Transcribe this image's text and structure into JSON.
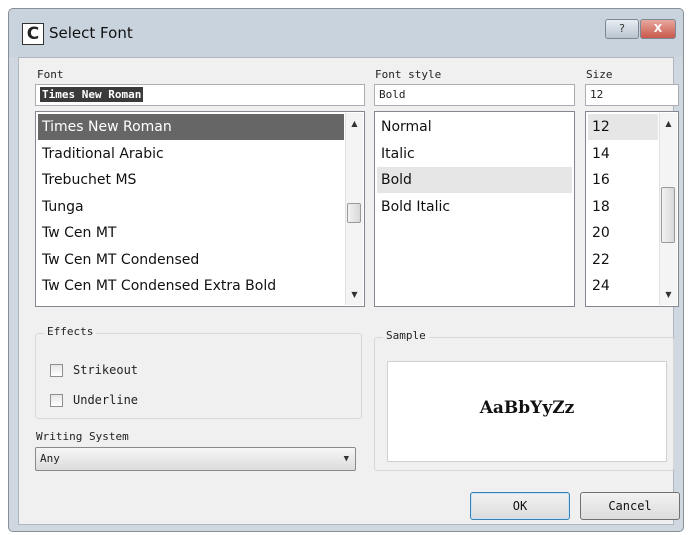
{
  "window": {
    "title": "Select Font",
    "app_icon": "C",
    "help_label": "?",
    "close_label": "X"
  },
  "font": {
    "label": "Font",
    "input_value": "Times New Roman",
    "items": [
      "Times New Roman",
      "Traditional Arabic",
      "Trebuchet MS",
      "Tunga",
      "Tw Cen MT",
      "Tw Cen MT Condensed",
      "Tw Cen MT Condensed Extra Bold"
    ],
    "selected": "Times New Roman"
  },
  "font_style": {
    "label": "Font style",
    "input_value": "Bold",
    "items": [
      "Normal",
      "Italic",
      "Bold",
      "Bold Italic"
    ],
    "selected": "Bold"
  },
  "size": {
    "label": "Size",
    "input_value": "12",
    "items": [
      "12",
      "14",
      "16",
      "18",
      "20",
      "22",
      "24"
    ],
    "selected": "12"
  },
  "effects": {
    "title": "Effects",
    "strikeout_label": "Strikeout",
    "underline_label": "Underline",
    "strikeout_checked": false,
    "underline_checked": false
  },
  "writing_system": {
    "label": "Writing System",
    "value": "Any"
  },
  "sample": {
    "title": "Sample",
    "text": "AaBbYyZz"
  },
  "buttons": {
    "ok": "OK",
    "cancel": "Cancel"
  },
  "colors": {
    "selected_dark": "#666666",
    "selected_light": "#e6e6e6",
    "titlebar": "#c9d3de",
    "close": "#c8584b"
  }
}
